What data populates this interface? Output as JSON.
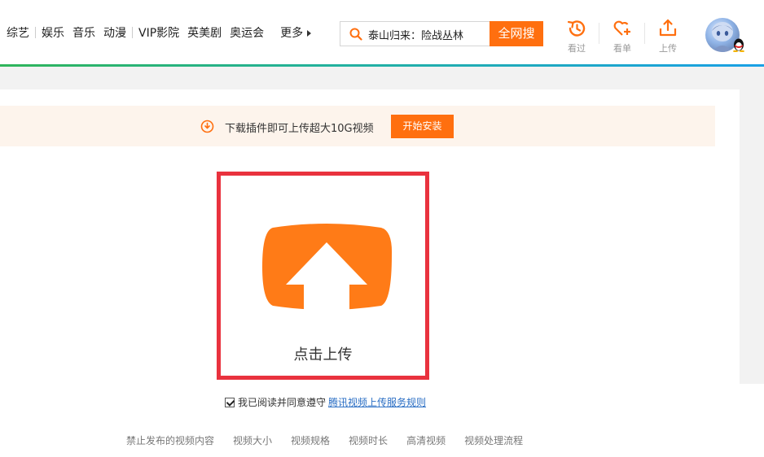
{
  "nav": {
    "items": [
      "综艺",
      "娱乐",
      "音乐",
      "动漫",
      "VIP影院",
      "英美剧",
      "奥运会"
    ],
    "more_label": "更多"
  },
  "search": {
    "query": "泰山归来：险战丛林",
    "button_label": "全网搜"
  },
  "toolbar": {
    "history_label": "看过",
    "watchlist_label": "看单",
    "upload_label": "上传"
  },
  "colors": {
    "accent": "#ff6f0f",
    "highlight_border": "#e9323e",
    "link": "#2a6ec4"
  },
  "notice": {
    "text": "下载插件即可上传超大10G视频",
    "button_label": "开始安装"
  },
  "upload": {
    "label": "点击上传"
  },
  "agreement": {
    "checked": true,
    "text": "我已阅读并同意遵守",
    "link": "腾讯视频上传服务规则"
  },
  "footer": {
    "links": [
      "禁止发布的视频内容",
      "视频大小",
      "视频规格",
      "视频时长",
      "高清视频",
      "视频处理流程"
    ]
  }
}
